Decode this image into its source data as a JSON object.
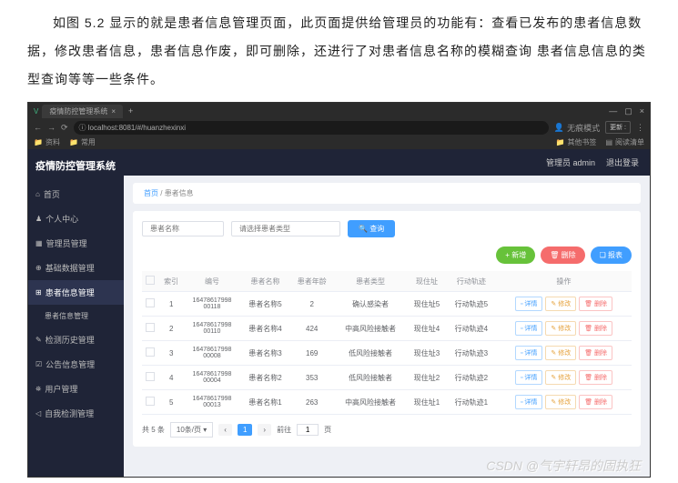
{
  "doc_paragraph": "如图 5.2 显示的就是患者信息管理页面，此页面提供给管理员的功能有：查看已发布的患者信息数据，修改患者信息，患者信息作废，即可删除，还进行了对患者信息名称的模糊查询 患者信息信息的类型查询等等一些条件。",
  "browser": {
    "tab_title": "疫情防控管理系统",
    "url": "localhost:8081/#/huanzhexinxi",
    "incognito": "无痕模式",
    "update_btn": "更新 :",
    "bookmarks_left": [
      "资料",
      "常用"
    ],
    "bookmarks_right": [
      "其他书签",
      "阅读清单"
    ]
  },
  "app": {
    "title": "疫情防控管理系统",
    "menu": [
      {
        "icon": "⌂",
        "label": "首页"
      },
      {
        "icon": "♟",
        "label": "个人中心"
      },
      {
        "icon": "▦",
        "label": "管理员管理"
      },
      {
        "icon": "⊕",
        "label": "基础数据管理"
      },
      {
        "icon": "⊞",
        "label": "患者信息管理",
        "active": true,
        "sub": "患者信息管理"
      },
      {
        "icon": "✎",
        "label": "检测历史管理"
      },
      {
        "icon": "☑",
        "label": "公告信息管理"
      },
      {
        "icon": "⛯",
        "label": "用户管理"
      },
      {
        "icon": "◁",
        "label": "自我检测管理"
      }
    ],
    "topbar": {
      "role": "管理员 admin",
      "logout": "退出登录"
    },
    "breadcrumb": {
      "home": "首页",
      "current": "患者信息"
    },
    "filters": {
      "name_ph": "患者名称",
      "type_ph": "请选择患者类型",
      "search": "查询"
    },
    "actions": {
      "add": "+ 新增",
      "delete": "🗑 删除",
      "report": "❏ 报表"
    },
    "columns": [
      "",
      "索引",
      "编号",
      "患者名称",
      "患者年龄",
      "患者类型",
      "现住址",
      "行动轨迹",
      "操作"
    ],
    "row_btns": {
      "detail": "▫ 详情",
      "edit": "✎ 修改",
      "delete": "🗑 删除"
    },
    "rows": [
      {
        "idx": "1",
        "no": "1647861799800118",
        "name": "患者名称5",
        "age": "2",
        "type": "确认感染者",
        "addr": "现住址5",
        "track": "行动轨迹5"
      },
      {
        "idx": "2",
        "no": "1647861799800110",
        "name": "患者名称4",
        "age": "424",
        "type": "中高风险接触者",
        "addr": "现住址4",
        "track": "行动轨迹4"
      },
      {
        "idx": "3",
        "no": "1647861799800008",
        "name": "患者名称3",
        "age": "169",
        "type": "低风险接触者",
        "addr": "现住址3",
        "track": "行动轨迹3"
      },
      {
        "idx": "4",
        "no": "1647861799800004",
        "name": "患者名称2",
        "age": "353",
        "type": "低风险接触者",
        "addr": "现住址2",
        "track": "行动轨迹2"
      },
      {
        "idx": "5",
        "no": "1647861799800013",
        "name": "患者名称1",
        "age": "263",
        "type": "中高风险接触者",
        "addr": "现住址1",
        "track": "行动轨迹1"
      }
    ],
    "pagination": {
      "total_label": "共 5 条",
      "per_page": "10条/页",
      "current": "1",
      "prev": "‹",
      "next": "›",
      "goto_label": "前往",
      "goto_val": "1",
      "page_suffix": "页"
    }
  },
  "watermark": "CSDN @气宇轩昂的固执狂"
}
